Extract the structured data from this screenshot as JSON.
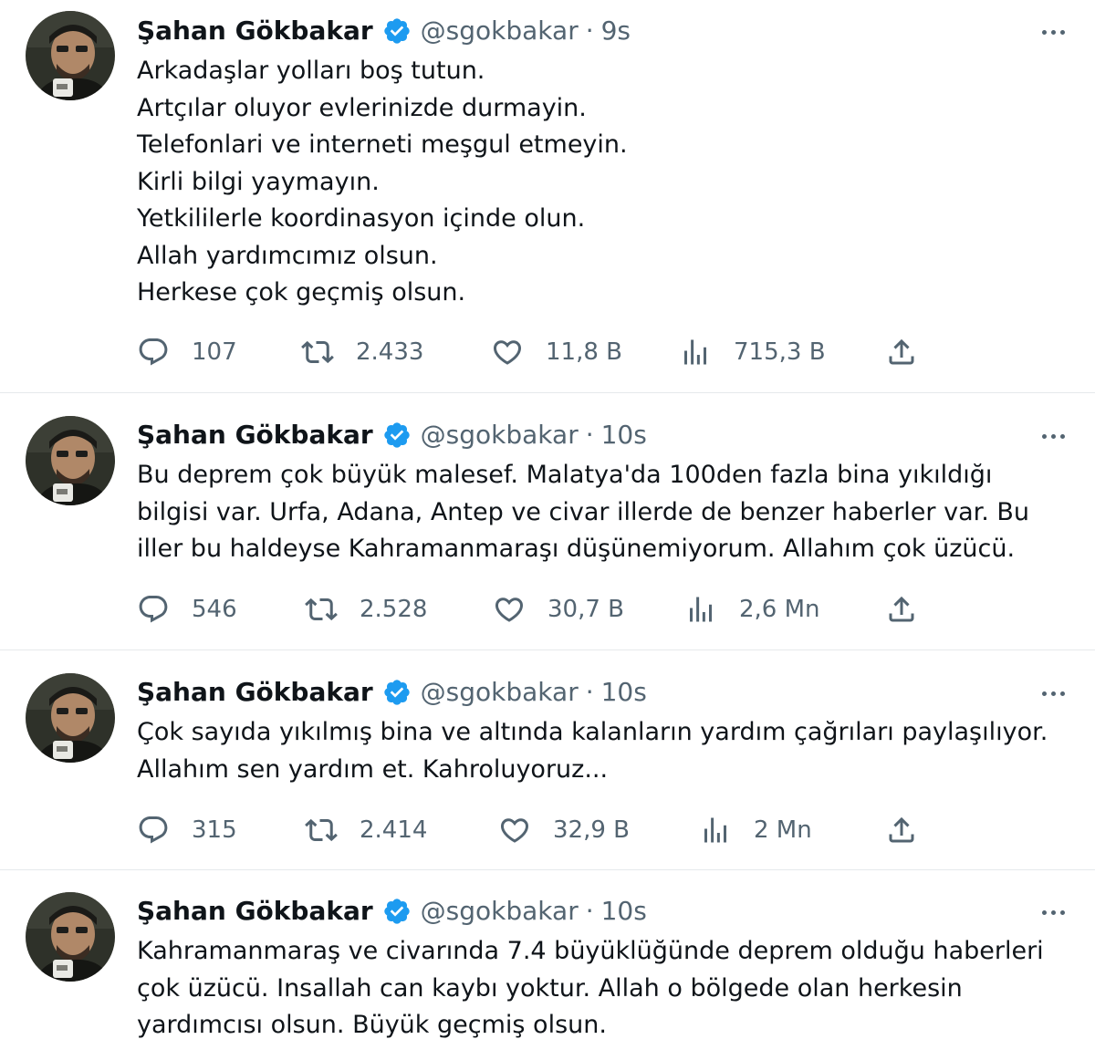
{
  "tweets": [
    {
      "author": "Şahan Gökbakar",
      "handle": "@sgokbakar",
      "separator": "·",
      "time": "9s",
      "lines": [
        "Arkadaşlar yolları boş tutun.",
        "Artçılar oluyor evlerinizde durmayin.",
        "Telefonlari ve interneti meşgul etmeyin.",
        "Kirli bilgi yaymayın.",
        "Yetkililerle koordinasyon içinde olun.",
        "Allah yardımcımız olsun.",
        "Herkese çok geçmiş olsun."
      ],
      "replies": "107",
      "retweets": "2.433",
      "likes": "11,8 B",
      "views": "715,3 B"
    },
    {
      "author": "Şahan Gökbakar",
      "handle": "@sgokbakar",
      "separator": "·",
      "time": "10s",
      "lines": [
        "Bu deprem çok büyük malesef. Malatya'da 100den fazla bina yıkıldığı",
        "bilgisi var. Urfa, Adana, Antep ve civar illerde de benzer haberler var. Bu",
        "iller bu haldeyse Kahramanmaraşı düşünemiyorum. Allahım çok üzücü."
      ],
      "replies": "546",
      "retweets": "2.528",
      "likes": "30,7 B",
      "views": "2,6 Mn"
    },
    {
      "author": "Şahan Gökbakar",
      "handle": "@sgokbakar",
      "separator": "·",
      "time": "10s",
      "lines": [
        "Çok sayıda yıkılmış bina ve altında kalanların yardım çağrıları paylaşılıyor.",
        "Allahım sen yardım et. Kahroluyoruz..."
      ],
      "replies": "315",
      "retweets": "2.414",
      "likes": "32,9 B",
      "views": "2 Mn"
    },
    {
      "author": "Şahan Gökbakar",
      "handle": "@sgokbakar",
      "separator": "·",
      "time": "10s",
      "lines": [
        "Kahramanmaraş ve civarında 7.4 büyüklüğünde deprem olduğu haberleri",
        "çok üzücü. Insallah can kaybı yoktur. Allah o bölgede olan herkesin",
        "yardımcısı olsun. Büyük geçmiş olsun."
      ]
    }
  ],
  "icons": {
    "verified": "verified-badge-icon",
    "more": "more-options-icon",
    "reply": "reply-bubble-icon",
    "retweet": "retweet-arrows-icon",
    "like": "heart-icon",
    "views": "bar-chart-icon",
    "share": "share-upload-icon"
  },
  "colors": {
    "text_primary": "#0f1419",
    "text_secondary": "#536471",
    "verified_blue": "#1d9bf0",
    "divider": "#e6e9ec",
    "background": "#ffffff"
  }
}
